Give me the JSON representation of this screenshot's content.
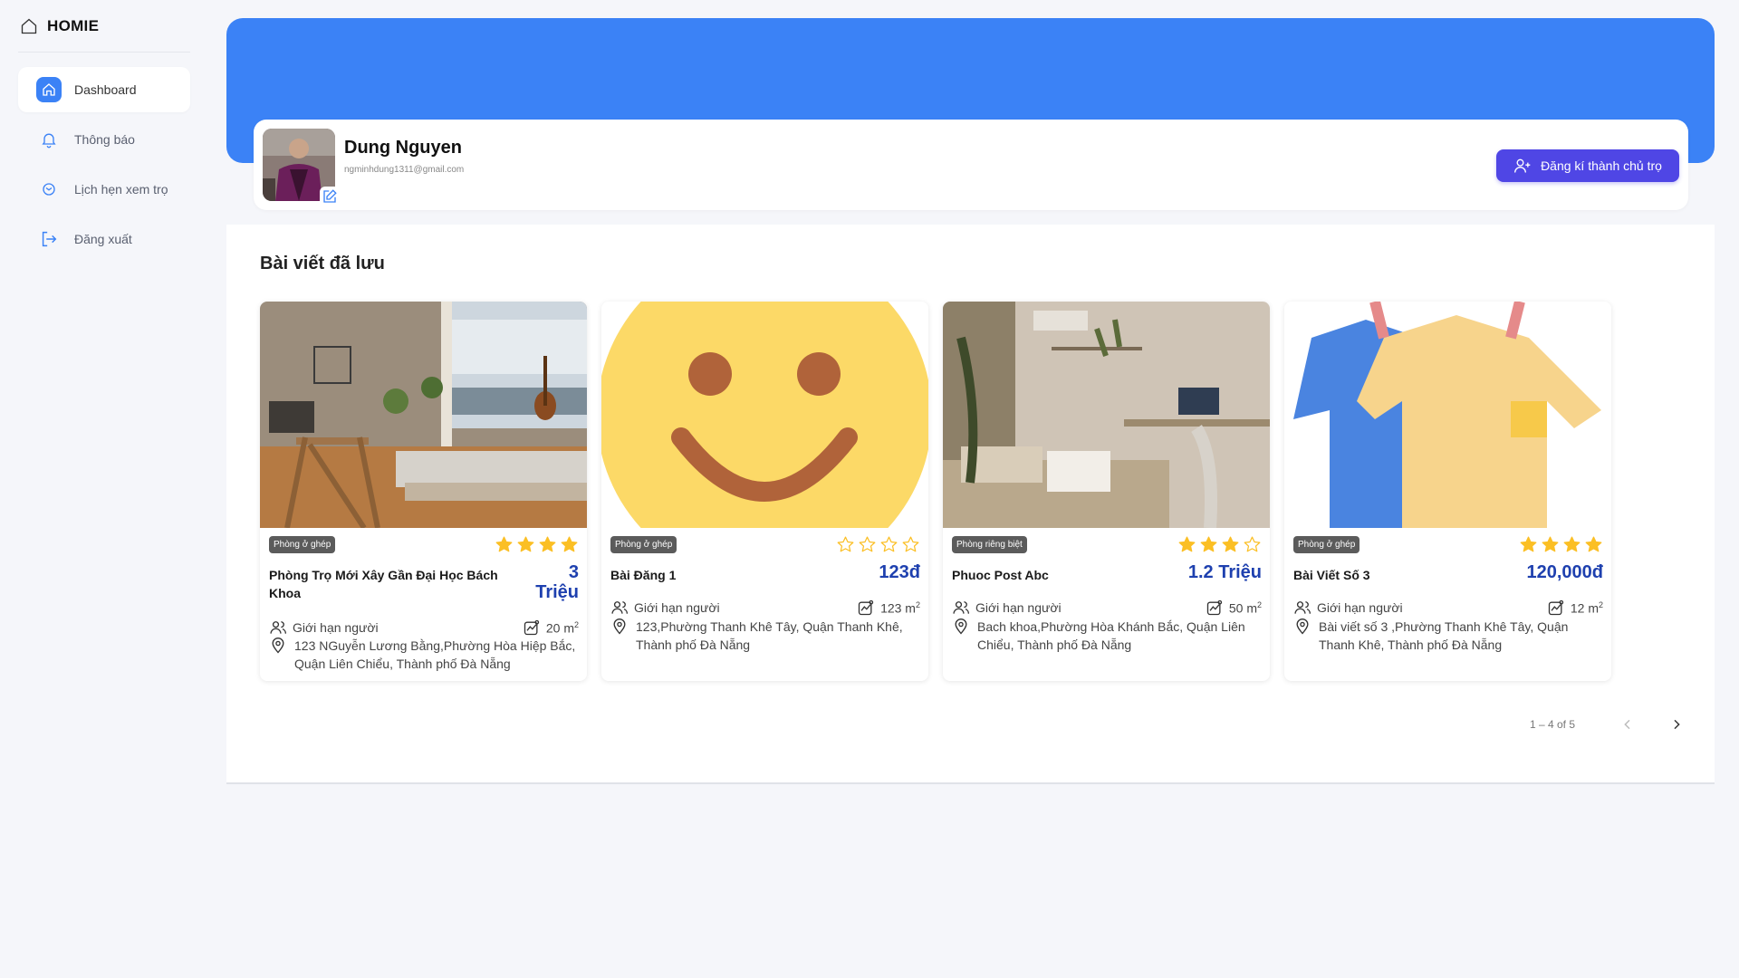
{
  "app": {
    "brand": "HOMIE"
  },
  "sidebar": {
    "items": [
      {
        "label": "Dashboard",
        "icon": "home-icon",
        "active": true
      },
      {
        "label": "Thông báo",
        "icon": "bell-icon"
      },
      {
        "label": "Lịch hẹn xem trọ",
        "icon": "mail-icon"
      },
      {
        "label": "Đăng xuất",
        "icon": "logout-icon"
      }
    ]
  },
  "profile": {
    "name": "Dung Nguyen",
    "email": "ngminhdung1311@gmail.com",
    "register_label": "Đăng kí thành chủ trọ"
  },
  "saved": {
    "title": "Bài viết đã lưu",
    "cards": [
      {
        "tag": "Phòng ở ghép",
        "rating": 4,
        "title": "Phòng Trọ Mới Xây Gần Đại Học Bách Khoa",
        "price": "3 Triệu",
        "people": "Giới hạn người",
        "area": "20 m",
        "address": "123 NGuyễn Lương Bằng,Phường Hòa Hiệp Bắc, Quận Liên Chiểu, Thành phố Đà Nẵng"
      },
      {
        "tag": "Phòng ở ghép",
        "rating": 0,
        "title": "Bài Đăng 1",
        "price": "123đ",
        "people": "Giới hạn người",
        "area": "123 m",
        "address": "123,Phường Thanh Khê Tây, Quận Thanh Khê, Thành phố Đà Nẵng"
      },
      {
        "tag": "Phòng riêng biệt",
        "rating": 3,
        "title": "Phuoc Post Abc",
        "price": "1.2 Triệu",
        "people": "Giới hạn người",
        "area": "50 m",
        "address": "Bach khoa,Phường Hòa Khánh Bắc, Quận Liên Chiểu, Thành phố Đà Nẵng"
      },
      {
        "tag": "Phòng ở ghép",
        "rating": 4,
        "title": "Bài Viết Số 3",
        "price": "120,000đ",
        "people": "Giới hạn người",
        "area": "12 m",
        "address": "Bài viết số 3 ,Phường Thanh Khê Tây, Quận Thanh Khê, Thành phố Đà Nẵng"
      }
    ],
    "area_sup": "2",
    "pagination": "1 – 4 of 5"
  },
  "colors": {
    "primary": "#3b82f6",
    "accent": "#4f46e5",
    "price": "#1e40af",
    "star": "#fbbf24"
  }
}
